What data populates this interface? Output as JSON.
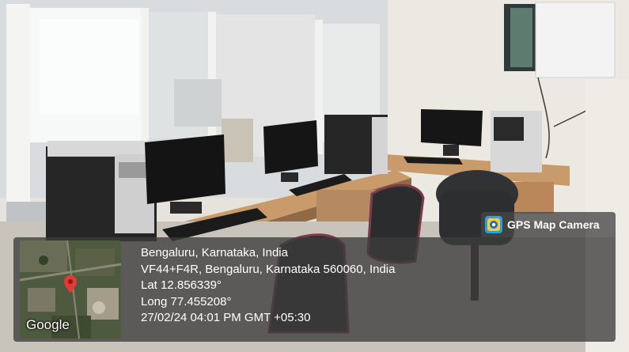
{
  "photo": {
    "description_icon": "photo-of-computer-lab"
  },
  "stamp": {
    "app_name": "GPS Map Camera",
    "app_icon": "gps-map-camera-icon",
    "map_provider": "Google",
    "map_pin_icon": "map-pin-icon",
    "location_title": "Bengaluru, Karnataka, India",
    "address": "VF44+F4R, Bengaluru, Karnataka 560060, India",
    "latitude": "Lat 12.856339°",
    "longitude": "Long 77.455208°",
    "datetime": "27/02/24 04:01 PM GMT +05:30"
  },
  "colors": {
    "overlay": "#3c3c3c",
    "pin": "#e53935",
    "text": "#ffffff"
  }
}
